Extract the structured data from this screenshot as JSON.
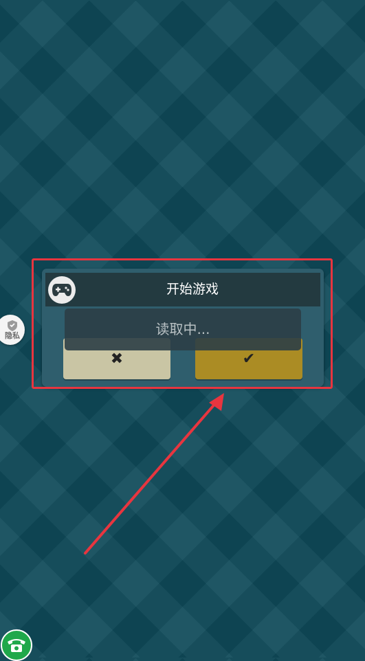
{
  "dialog": {
    "title": "开始游戏",
    "loading_text": "读取中...",
    "cancel_label": "✖",
    "confirm_label": "✔"
  },
  "side_badge": {
    "label": "隐私"
  },
  "icons": {
    "gamepad": "gamepad-icon",
    "shield": "shield-icon",
    "phone": "phone-icon"
  },
  "colors": {
    "background": "#0e4a58",
    "highlight": "#e8353f",
    "title_bar": "#233a40",
    "cancel_button": "#c9c5a4",
    "confirm_button": "#ab8c24"
  }
}
